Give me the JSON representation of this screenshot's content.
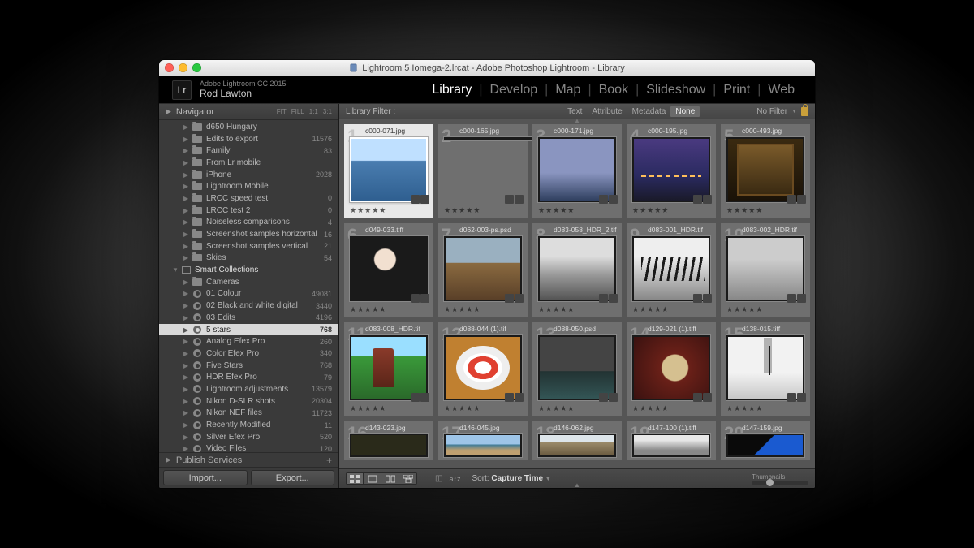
{
  "titlebar": {
    "title": "Lightroom 5 Iomega-2.lrcat - Adobe Photoshop Lightroom - Library",
    "traffic": {
      "close": "#ff5f57",
      "min": "#febc2e",
      "max": "#28c840"
    }
  },
  "identity": {
    "logo": "Lr",
    "product": "Adobe Lightroom CC 2015",
    "user": "Rod Lawton"
  },
  "modules": [
    "Library",
    "Develop",
    "Map",
    "Book",
    "Slideshow",
    "Print",
    "Web"
  ],
  "active_module": "Library",
  "navigator": {
    "title": "Navigator",
    "zooms": [
      "FIT",
      "FILL",
      "1:1",
      "3:1"
    ]
  },
  "publish": {
    "title": "Publish Services"
  },
  "buttons": {
    "import": "Import...",
    "export": "Export..."
  },
  "filterbar": {
    "label": "Library Filter :",
    "tabs": [
      "Text",
      "Attribute",
      "Metadata",
      "None"
    ],
    "active": "None",
    "nofilter": "No Filter"
  },
  "toolbar": {
    "sort_label": "Sort:",
    "sort_value": "Capture Time",
    "thumb_label": "Thumbnails"
  },
  "tree": [
    {
      "lvl": 2,
      "icon": "folder",
      "label": "d650 Hungary",
      "count": ""
    },
    {
      "lvl": 2,
      "icon": "folder",
      "label": "Edits to export",
      "count": "11576"
    },
    {
      "lvl": 2,
      "icon": "folder",
      "label": "Family",
      "count": "83"
    },
    {
      "lvl": 2,
      "icon": "folder",
      "label": "From Lr mobile",
      "count": ""
    },
    {
      "lvl": 2,
      "icon": "folder",
      "label": "iPhone",
      "count": "2028"
    },
    {
      "lvl": 2,
      "icon": "folder",
      "label": "Lightroom Mobile",
      "count": ""
    },
    {
      "lvl": 2,
      "icon": "folder",
      "label": "LRCC speed test",
      "count": "0"
    },
    {
      "lvl": 2,
      "icon": "folder",
      "label": "LRCC test 2",
      "count": "0"
    },
    {
      "lvl": 2,
      "icon": "folder",
      "label": "Noiseless comparisons",
      "count": "4"
    },
    {
      "lvl": 2,
      "icon": "folder",
      "label": "Screenshot samples horizontal",
      "count": "16"
    },
    {
      "lvl": 2,
      "icon": "folder",
      "label": "Screenshot samples vertical",
      "count": "21"
    },
    {
      "lvl": 2,
      "icon": "folder",
      "label": "Skies",
      "count": "54"
    },
    {
      "lvl": 1,
      "icon": "box",
      "label": "Smart Collections",
      "count": "",
      "open": true
    },
    {
      "lvl": 2,
      "icon": "folder",
      "label": "Cameras",
      "count": ""
    },
    {
      "lvl": 2,
      "icon": "gear",
      "label": "01 Colour",
      "count": "49081"
    },
    {
      "lvl": 2,
      "icon": "gear",
      "label": "02 Black and white digital",
      "count": "3440"
    },
    {
      "lvl": 2,
      "icon": "gear",
      "label": "03 Edits",
      "count": "4196"
    },
    {
      "lvl": 2,
      "icon": "gear",
      "label": "5 stars",
      "count": "768",
      "selected": true
    },
    {
      "lvl": 2,
      "icon": "gear",
      "label": "Analog Efex Pro",
      "count": "260"
    },
    {
      "lvl": 2,
      "icon": "gear",
      "label": "Color Efex Pro",
      "count": "340"
    },
    {
      "lvl": 2,
      "icon": "gear",
      "label": "Five Stars",
      "count": "768"
    },
    {
      "lvl": 2,
      "icon": "gear",
      "label": "HDR Efex Pro",
      "count": "79"
    },
    {
      "lvl": 2,
      "icon": "gear",
      "label": "Lightroom adjustments",
      "count": "13579"
    },
    {
      "lvl": 2,
      "icon": "gear",
      "label": "Nikon D-SLR shots",
      "count": "20304"
    },
    {
      "lvl": 2,
      "icon": "gear",
      "label": "Nikon NEF files",
      "count": "11723"
    },
    {
      "lvl": 2,
      "icon": "gear",
      "label": "Recently Modified",
      "count": "11"
    },
    {
      "lvl": 2,
      "icon": "gear",
      "label": "Silver Efex Pro",
      "count": "520"
    },
    {
      "lvl": 2,
      "icon": "gear",
      "label": "Video Files",
      "count": "120"
    }
  ],
  "cells": [
    {
      "n": 1,
      "f": "c000-071.jpg",
      "t": "t-ocean",
      "sel": true
    },
    {
      "n": 2,
      "f": "c000-165.jpg",
      "t": "t-sunset"
    },
    {
      "n": 3,
      "f": "c000-171.jpg",
      "t": "t-boats"
    },
    {
      "n": 4,
      "f": "c000-195.jpg",
      "t": "t-pier"
    },
    {
      "n": 5,
      "f": "c000-493.jpg",
      "t": "t-night"
    },
    {
      "n": 6,
      "f": "d049-033.tiff",
      "t": "t-girl"
    },
    {
      "n": 7,
      "f": "d062-003-ps.psd",
      "t": "t-building"
    },
    {
      "n": 8,
      "f": "d083-058_HDR_2.tif",
      "t": "t-beach"
    },
    {
      "n": 9,
      "f": "d083-001_HDR.tif",
      "t": "t-fence"
    },
    {
      "n": 10,
      "f": "d083-002_HDR.tif",
      "t": "t-grass"
    },
    {
      "n": 11,
      "f": "d083-008_HDR.tif",
      "t": "t-silo"
    },
    {
      "n": 12,
      "f": "d088-044 (1).tif",
      "t": "t-ring"
    },
    {
      "n": 13,
      "f": "d088-050.psd",
      "t": "t-storm"
    },
    {
      "n": 14,
      "f": "d129-021 (1).tiff",
      "t": "t-clock"
    },
    {
      "n": 15,
      "f": "d138-015.tiff",
      "t": "t-tree"
    },
    {
      "n": 16,
      "f": "d143-023.jpg",
      "t": "t-window"
    },
    {
      "n": 17,
      "f": "d146-045.jpg",
      "t": "t-coast"
    },
    {
      "n": 18,
      "f": "d146-062.jpg",
      "t": "t-dunes"
    },
    {
      "n": 19,
      "f": "d147-100 (1).tiff",
      "t": "t-monobldg"
    },
    {
      "n": 20,
      "f": "d147-159.jpg",
      "t": "t-blue"
    }
  ]
}
